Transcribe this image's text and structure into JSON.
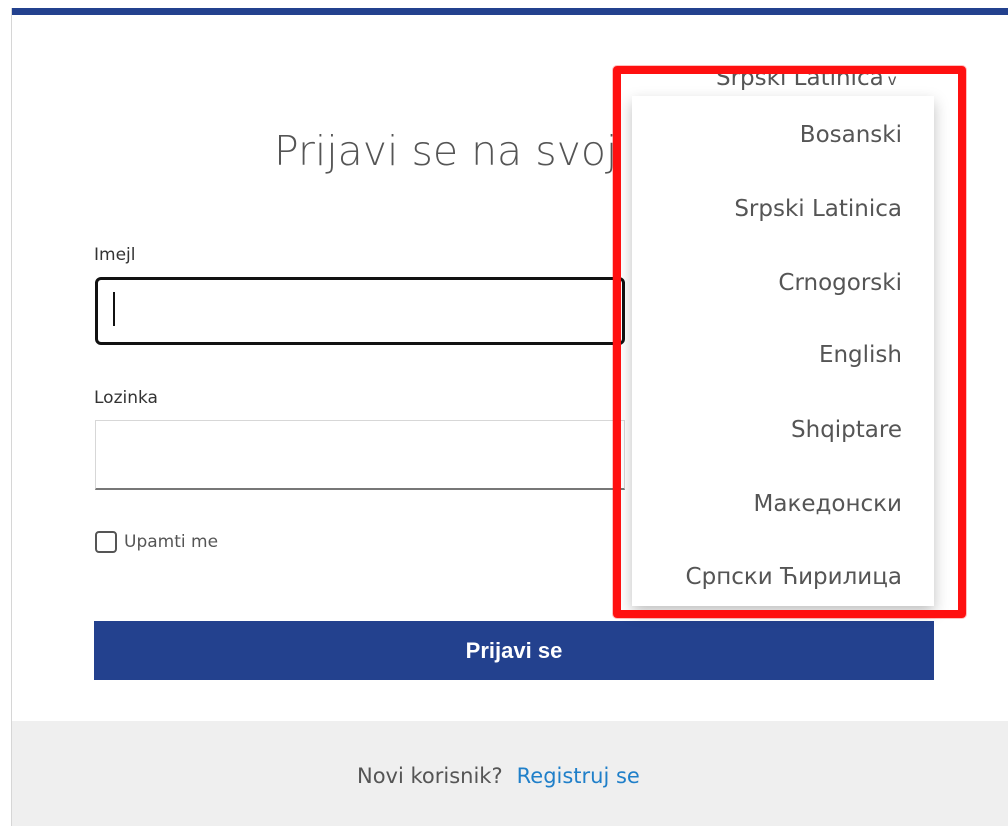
{
  "language": {
    "current": "Srpski Latinica",
    "chevron": "v",
    "options": [
      "Bosanski",
      "Srpski Latinica",
      "Crnogorski",
      "English",
      "Shqiptare",
      "Македонски",
      "Српски Ћирилица"
    ]
  },
  "login": {
    "title": "Prijavi se na svoj",
    "email_label": "Imejl",
    "email_value": "",
    "password_label": "Lozinka",
    "password_value": "",
    "remember_label": "Upamti me",
    "remember_checked": false,
    "submit_label": "Prijavi se"
  },
  "footer": {
    "new_user_text": "Novi korisnik?",
    "register_link": "Registruj se"
  },
  "colors": {
    "brand": "#23418e",
    "link": "#1f7fc9",
    "highlight": "#ff1010",
    "footer": "#efefef"
  }
}
